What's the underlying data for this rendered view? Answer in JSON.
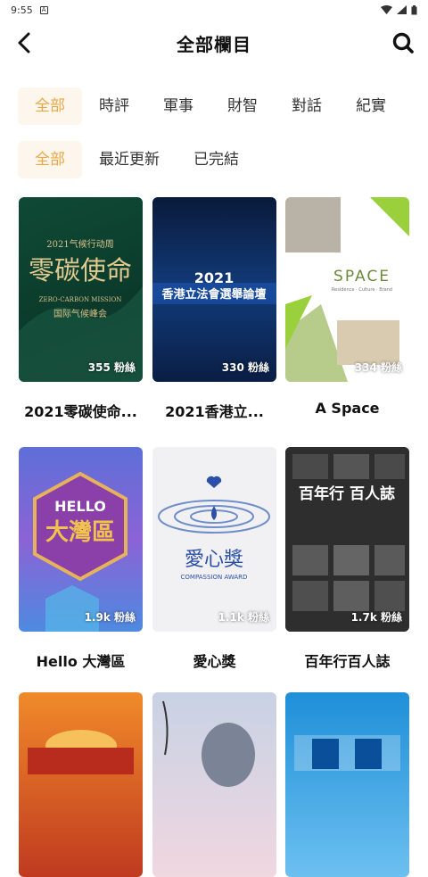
{
  "status_bar": {
    "time": "9:55"
  },
  "header": {
    "title": "全部欄目"
  },
  "tabs": [
    "全部",
    "時評",
    "軍事",
    "財智",
    "對話",
    "紀實"
  ],
  "filters": [
    "全部",
    "最近更新",
    "已完結"
  ],
  "cards": [
    {
      "name": "2021零碳使命...",
      "fans": "355 粉絲",
      "art": {
        "line1": "2021气候行动周",
        "line2": "零碳使命",
        "line3": "ZERO-CARBON MISSION",
        "line4": "国际气候峰会"
      }
    },
    {
      "name": "2021香港立...",
      "fans": "330 粉絲",
      "art": {
        "line1": "2021",
        "line2": "香港立法會選舉論壇"
      }
    },
    {
      "name": "A Space",
      "fans": "334 粉絲",
      "art": {
        "line1": "SPACE",
        "line2": "Residence · Culture · Brand"
      }
    },
    {
      "name": "Hello 大灣區",
      "fans": "1.9k 粉絲",
      "art": {
        "line1": "HELLO",
        "line2": "大灣區"
      }
    },
    {
      "name": "愛心獎",
      "fans": "1.1k 粉絲",
      "art": {
        "line1": "愛心獎",
        "line2": "COMPASSION AWARD"
      }
    },
    {
      "name": "百年行百人誌",
      "fans": "1.7k 粉絲",
      "art": {
        "line1": "百年行 百人誌"
      }
    },
    {
      "name": "",
      "fans": "",
      "art": {
        "line1": ""
      }
    },
    {
      "name": "",
      "fans": "",
      "art": {
        "line1": ""
      }
    },
    {
      "name": "",
      "fans": "",
      "art": {
        "line1": ""
      }
    }
  ],
  "colors": {
    "accent": "#e9a844",
    "accent_bg": "#fdf6ec"
  }
}
